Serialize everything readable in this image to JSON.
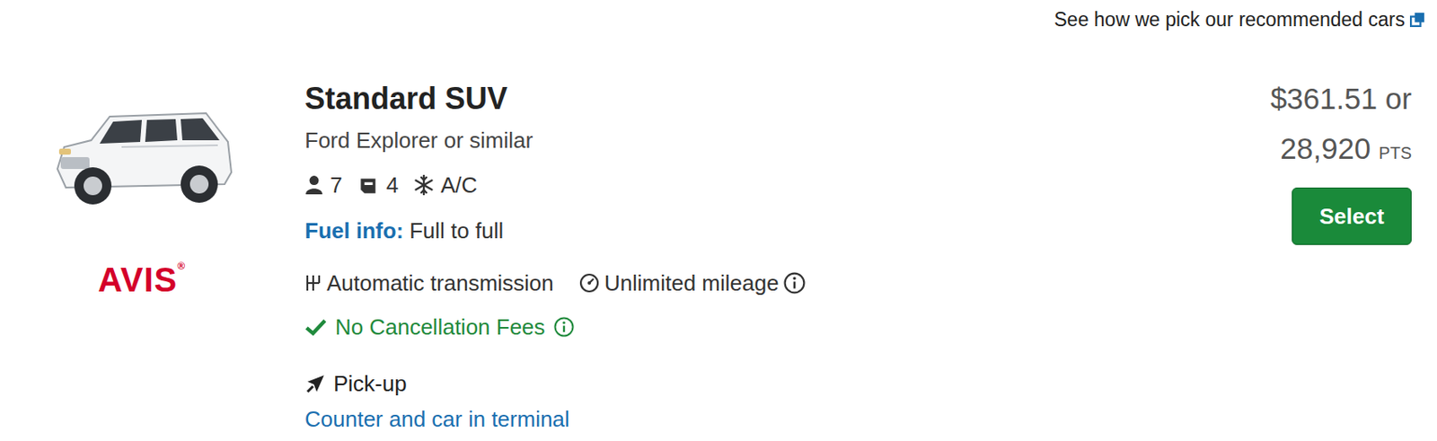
{
  "header": {
    "link": "See how we pick our recommended cars"
  },
  "car": {
    "category": "Standard SUV",
    "model": "Ford Explorer or similar",
    "vendor": {
      "name": "AVIS",
      "mark": "®"
    },
    "features": [
      {
        "kind": "passengers",
        "label": "7"
      },
      {
        "kind": "bags",
        "label": "4"
      },
      {
        "kind": "climate",
        "label": "A/C"
      }
    ],
    "fuel": {
      "label": "Fuel info:",
      "value": "Full to full"
    },
    "specs": [
      {
        "kind": "transmission",
        "label": "Automatic transmission",
        "info": false
      },
      {
        "kind": "mileage",
        "label": "Unlimited mileage",
        "info": true
      }
    ],
    "cancellation": {
      "label": "No Cancellation Fees",
      "info": true
    },
    "pickup": {
      "label": "Pick-up",
      "value": "Counter and car in terminal"
    }
  },
  "price": {
    "amount": "$361.51 or",
    "points": "28,920",
    "unit": "PTS"
  },
  "buttons": [
    "Select"
  ]
}
